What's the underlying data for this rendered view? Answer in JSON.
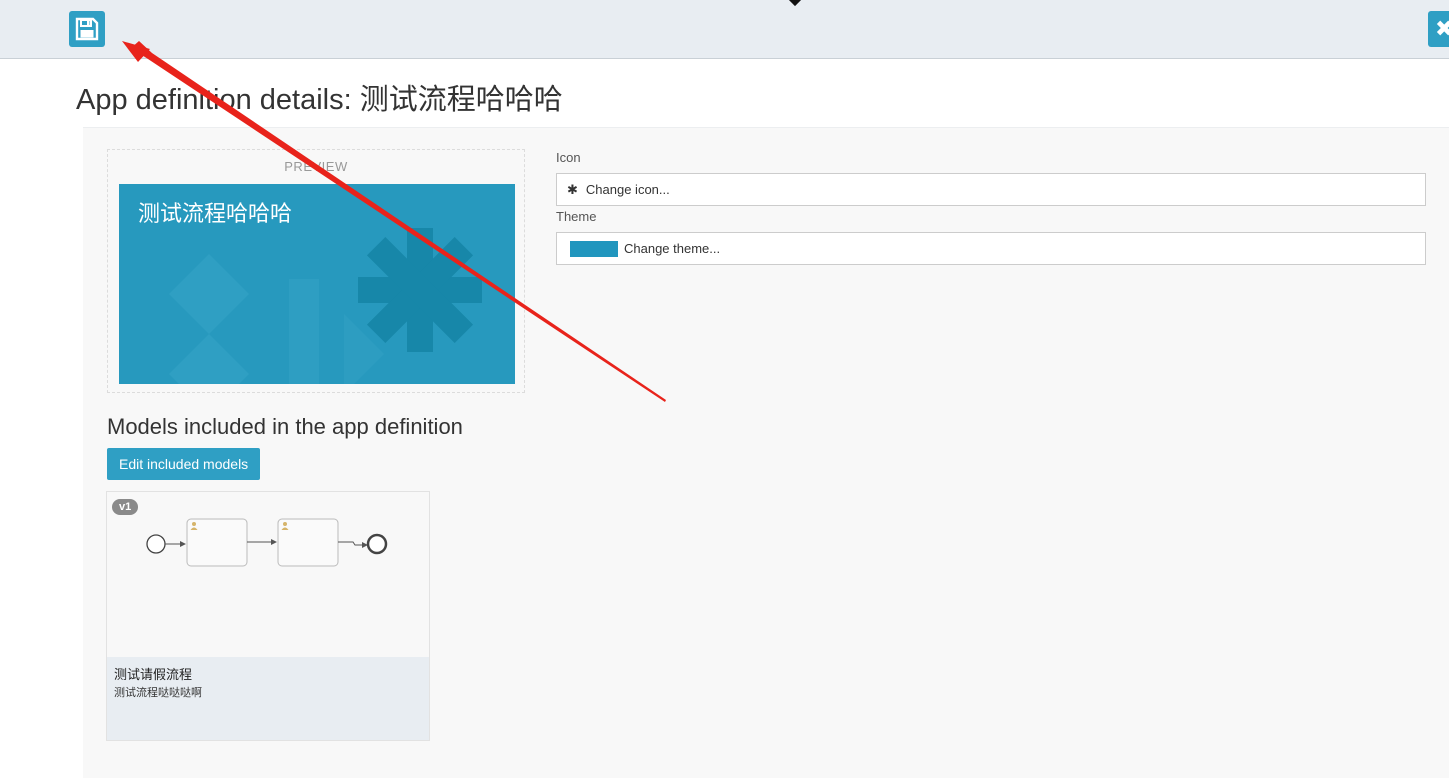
{
  "toolbar": {
    "save_icon": "save-floppy-icon",
    "close_icon": "close-icon",
    "accent": "#2f9fc4"
  },
  "page": {
    "title": "App definition details: 测试流程哈哈哈"
  },
  "preview": {
    "label": "PREVIEW",
    "tile_title": "测试流程哈哈哈",
    "tile_color": "#2799be",
    "tile_icon": "asterisk-icon"
  },
  "form": {
    "icon_label": "Icon",
    "icon_glyph": "✱",
    "icon_button": "Change icon...",
    "theme_label": "Theme",
    "theme_button": "Change theme...",
    "theme_color": "#2196be"
  },
  "models": {
    "section_title": "Models included in the app definition",
    "edit_button": "Edit included models",
    "items": [
      {
        "version": "v1",
        "name": "测试请假流程",
        "description": "测试流程哒哒哒啊",
        "thumbnail_icon": "bpmn-process-diagram"
      }
    ]
  },
  "annotation": {
    "type": "red-arrow",
    "color": "#e8231b"
  }
}
